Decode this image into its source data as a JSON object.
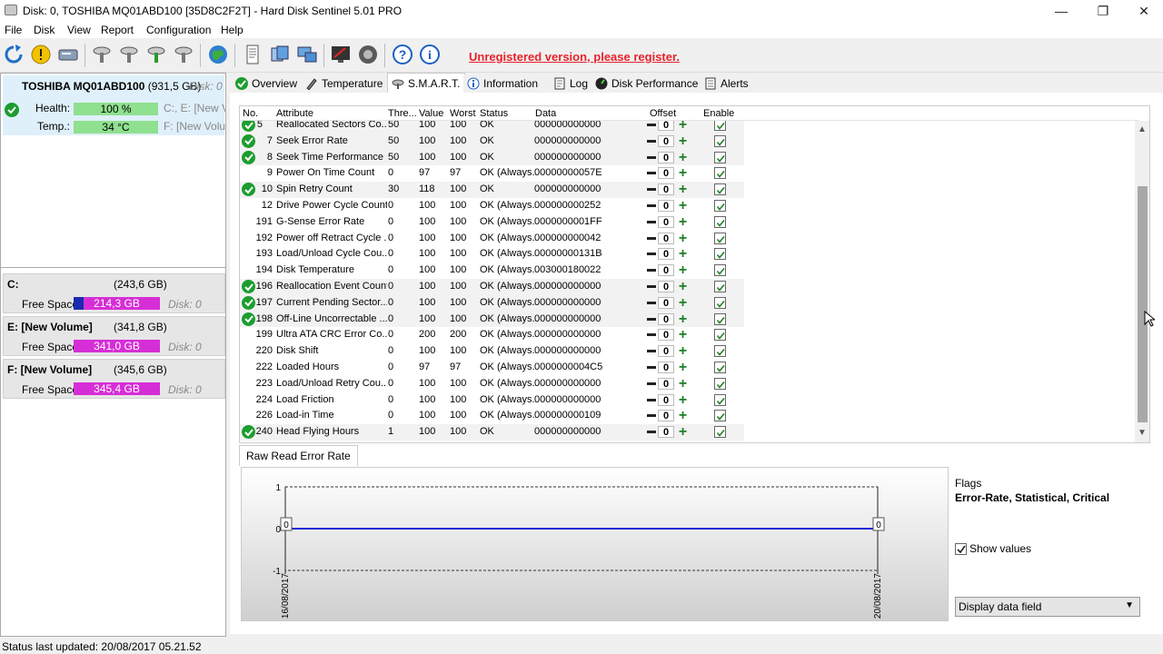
{
  "window": {
    "title": "Disk: 0, TOSHIBA MQ01ABD100 [35D8C2F2T]  -  Hard Disk Sentinel 5.01 PRO",
    "minimize": "—",
    "maximize": "❐",
    "close": "✕"
  },
  "menu": [
    "File",
    "Disk",
    "View",
    "Report",
    "Configuration",
    "Help"
  ],
  "toolbar": {
    "notice": "Unregistered version, please register."
  },
  "disk": {
    "name": "TOSHIBA MQ01ABD100",
    "size": "(931,5 GB)",
    "index": "Disk: 0",
    "health_label": "Health:",
    "health_value": "100 %",
    "health_percent": 100,
    "temp_label": "Temp.:",
    "temp_value": "34 °C",
    "vol_line1": "C:, E: [New Vo",
    "vol_line2": "F: [New Volur"
  },
  "volumes": [
    {
      "name": "C:",
      "size": "(243,6 GB)",
      "free_label": "Free Space",
      "free": "214,3 GB",
      "used_percent": 12,
      "disk": "Disk: 0"
    },
    {
      "name": "E: [New Volume]",
      "size": "(341,8 GB)",
      "free_label": "Free Space",
      "free": "341,0 GB",
      "used_percent": 0,
      "disk": "Disk: 0"
    },
    {
      "name": "F: [New Volume]",
      "size": "(345,6 GB)",
      "free_label": "Free Space",
      "free": "345,4 GB",
      "used_percent": 0,
      "disk": "Disk: 0"
    }
  ],
  "tabs": [
    "Overview",
    "Temperature",
    "S.M.A.R.T.",
    "Information",
    "Log",
    "Disk Performance",
    "Alerts"
  ],
  "smart": {
    "headers": {
      "no": "No.",
      "attr": "Attribute",
      "thr": "Thre...",
      "val": "Value",
      "worst": "Worst",
      "status": "Status",
      "data": "Data",
      "offset": "Offset",
      "enable": "Enable"
    },
    "rows": [
      {
        "ok": true,
        "no": "5",
        "attr": "Reallocated Sectors Co...",
        "thr": "50",
        "val": "100",
        "worst": "100",
        "status": "OK",
        "data": "000000000000",
        "offset": "0"
      },
      {
        "ok": true,
        "no": "7",
        "attr": "Seek Error Rate",
        "thr": "50",
        "val": "100",
        "worst": "100",
        "status": "OK",
        "data": "000000000000",
        "offset": "0"
      },
      {
        "ok": true,
        "no": "8",
        "attr": "Seek Time Performance",
        "thr": "50",
        "val": "100",
        "worst": "100",
        "status": "OK",
        "data": "000000000000",
        "offset": "0"
      },
      {
        "ok": false,
        "no": "9",
        "attr": "Power On Time Count",
        "thr": "0",
        "val": "97",
        "worst": "97",
        "status": "OK (Always...",
        "data": "00000000057E",
        "offset": "0"
      },
      {
        "ok": true,
        "no": "10",
        "attr": "Spin Retry Count",
        "thr": "30",
        "val": "118",
        "worst": "100",
        "status": "OK",
        "data": "000000000000",
        "offset": "0"
      },
      {
        "ok": false,
        "no": "12",
        "attr": "Drive Power Cycle Count",
        "thr": "0",
        "val": "100",
        "worst": "100",
        "status": "OK (Always...",
        "data": "000000000252",
        "offset": "0"
      },
      {
        "ok": false,
        "no": "191",
        "attr": "G-Sense Error Rate",
        "thr": "0",
        "val": "100",
        "worst": "100",
        "status": "OK (Always...",
        "data": "0000000001FF",
        "offset": "0"
      },
      {
        "ok": false,
        "no": "192",
        "attr": "Power off Retract Cycle ...",
        "thr": "0",
        "val": "100",
        "worst": "100",
        "status": "OK (Always...",
        "data": "000000000042",
        "offset": "0"
      },
      {
        "ok": false,
        "no": "193",
        "attr": "Load/Unload Cycle Cou...",
        "thr": "0",
        "val": "100",
        "worst": "100",
        "status": "OK (Always...",
        "data": "00000000131B",
        "offset": "0"
      },
      {
        "ok": false,
        "no": "194",
        "attr": "Disk Temperature",
        "thr": "0",
        "val": "100",
        "worst": "100",
        "status": "OK (Always...",
        "data": "003000180022",
        "offset": "0"
      },
      {
        "ok": true,
        "no": "196",
        "attr": "Reallocation Event Count",
        "thr": "0",
        "val": "100",
        "worst": "100",
        "status": "OK (Always...",
        "data": "000000000000",
        "offset": "0"
      },
      {
        "ok": true,
        "no": "197",
        "attr": "Current Pending Sector...",
        "thr": "0",
        "val": "100",
        "worst": "100",
        "status": "OK (Always...",
        "data": "000000000000",
        "offset": "0"
      },
      {
        "ok": true,
        "no": "198",
        "attr": "Off-Line Uncorrectable ...",
        "thr": "0",
        "val": "100",
        "worst": "100",
        "status": "OK (Always...",
        "data": "000000000000",
        "offset": "0"
      },
      {
        "ok": false,
        "no": "199",
        "attr": "Ultra ATA CRC Error Co...",
        "thr": "0",
        "val": "200",
        "worst": "200",
        "status": "OK (Always...",
        "data": "000000000000",
        "offset": "0"
      },
      {
        "ok": false,
        "no": "220",
        "attr": "Disk Shift",
        "thr": "0",
        "val": "100",
        "worst": "100",
        "status": "OK (Always...",
        "data": "000000000000",
        "offset": "0"
      },
      {
        "ok": false,
        "no": "222",
        "attr": "Loaded Hours",
        "thr": "0",
        "val": "97",
        "worst": "97",
        "status": "OK (Always...",
        "data": "0000000004C5",
        "offset": "0"
      },
      {
        "ok": false,
        "no": "223",
        "attr": "Load/Unload Retry Cou...",
        "thr": "0",
        "val": "100",
        "worst": "100",
        "status": "OK (Always...",
        "data": "000000000000",
        "offset": "0"
      },
      {
        "ok": false,
        "no": "224",
        "attr": "Load Friction",
        "thr": "0",
        "val": "100",
        "worst": "100",
        "status": "OK (Always...",
        "data": "000000000000",
        "offset": "0"
      },
      {
        "ok": false,
        "no": "226",
        "attr": "Load-in Time",
        "thr": "0",
        "val": "100",
        "worst": "100",
        "status": "OK (Always...",
        "data": "000000000109",
        "offset": "0"
      },
      {
        "ok": true,
        "no": "240",
        "attr": "Head Flying Hours",
        "thr": "1",
        "val": "100",
        "worst": "100",
        "status": "OK",
        "data": "000000000000",
        "offset": "0"
      }
    ]
  },
  "detail": {
    "tab": "Raw Read Error Rate",
    "flags_label": "Flags",
    "flags_value": "Error-Rate, Statistical, Critical",
    "show_values": "Show values",
    "dropdown": "Display data field"
  },
  "chart_data": {
    "type": "line",
    "x": [
      "16/08/2017",
      "20/08/2017"
    ],
    "series": [
      {
        "values": [
          0,
          0
        ]
      }
    ],
    "point_labels": [
      "0",
      "0"
    ],
    "ylim": [
      -1,
      1
    ],
    "yticks": [
      "1",
      "0",
      "-1"
    ],
    "line_color": "#1a2bd6"
  },
  "status": {
    "text": "Status last updated: 20/08/2017 05.21.52"
  }
}
